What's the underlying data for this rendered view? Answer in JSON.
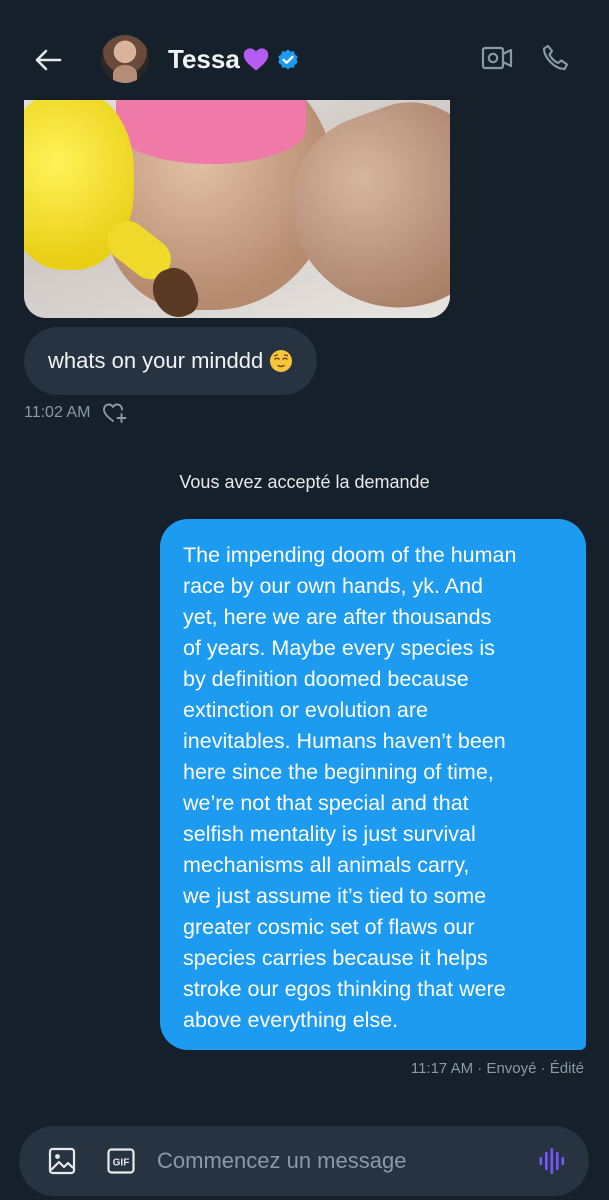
{
  "header": {
    "contact_name": "Tessa",
    "icons": {
      "back": "back-arrow-icon",
      "name_emoji": "purple-heart-icon",
      "verified": "verified-badge-icon",
      "video": "video-camera-icon",
      "call": "phone-icon"
    }
  },
  "messages": {
    "incoming": {
      "text": "whats on your minddd",
      "emoji": "relieved-face-emoji",
      "time": "11:02 AM"
    },
    "system_note": "Vous avez accepté la demande",
    "outgoing": {
      "lines": [
        "The impending doom of the human",
        "race by our own hands, yk. And",
        "yet, here we are after thousands",
        "of years. Maybe every species is",
        "by definition doomed because",
        "extinction or evolution are",
        "inevitables. Humans haven’t been",
        "here since the beginning of time,",
        "we’re not that special and that",
        "selfish mentality is just survival",
        "mechanisms all animals carry,",
        "we just assume it’s tied to some",
        "greater cosmic set of flaws our",
        "species carries because it helps",
        "stroke our egos thinking that were",
        "above everything else."
      ],
      "meta": "11:17 AM · Envoyé · Édité"
    }
  },
  "composer": {
    "placeholder": "Commencez un message",
    "gif_label": "GIF"
  },
  "colors": {
    "background": "#15202b",
    "incoming_bubble": "#273340",
    "outgoing_bubble": "#1d9bf0",
    "verified": "#1d9bf0",
    "voice": "#7856ff",
    "muted": "#8b98a5"
  }
}
